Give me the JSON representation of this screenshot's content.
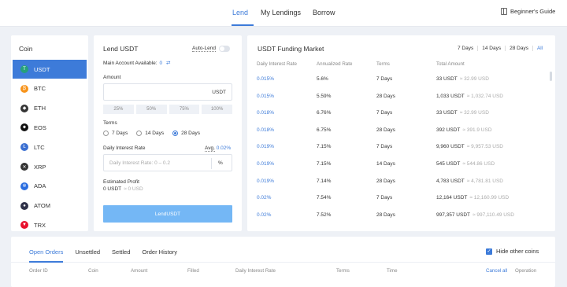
{
  "nav": {
    "tabs": [
      "Lend",
      "My Lendings",
      "Borrow"
    ],
    "guide": "Beginner's Guide"
  },
  "coins": {
    "title": "Coin",
    "items": [
      {
        "symbol": "USDT",
        "color": "#26a17b",
        "glyph": "T"
      },
      {
        "symbol": "BTC",
        "color": "#f7931a",
        "glyph": "₿"
      },
      {
        "symbol": "ETH",
        "color": "#333333",
        "glyph": "◆"
      },
      {
        "symbol": "EOS",
        "color": "#111111",
        "glyph": "⬥"
      },
      {
        "symbol": "LTC",
        "color": "#3b6fd1",
        "glyph": "Ł"
      },
      {
        "symbol": "XRP",
        "color": "#333333",
        "glyph": "✕"
      },
      {
        "symbol": "ADA",
        "color": "#2a6de0",
        "glyph": "✲"
      },
      {
        "symbol": "ATOM",
        "color": "#2e3148",
        "glyph": "●"
      },
      {
        "symbol": "TRX",
        "color": "#e8112d",
        "glyph": "▼"
      }
    ]
  },
  "lend": {
    "title": "Lend USDT",
    "auto_lend": "Auto-Lend",
    "available_label": "Main Account Available:",
    "available_value": "0",
    "amount_label": "Amount",
    "amount_unit": "USDT",
    "percents": [
      "25%",
      "50%",
      "75%",
      "100%"
    ],
    "terms_label": "Terms",
    "terms": [
      "7 Days",
      "14 Days",
      "28 Days"
    ],
    "selected_term": "28 Days",
    "rate_label": "Daily Interest Rate",
    "avg_label": "Avg.",
    "avg_value": "0.02%",
    "rate_placeholder": "Daily Interest Rate: 0 – 0.2",
    "rate_unit": "%",
    "profit_label": "Estimated Profit",
    "profit_value": "0 USDT",
    "profit_sub": "≈ 0 USD",
    "button": "LendUSDT"
  },
  "market": {
    "title": "USDT Funding Market",
    "ranges": [
      "7 Days",
      "14 Days",
      "28 Days",
      "All"
    ],
    "headers": [
      "Daily Interest Rate",
      "Annualized Rate",
      "Terms",
      "Total Amount"
    ],
    "rows": [
      {
        "rate": "0.015%",
        "annual": "5.6%",
        "terms": "7 Days",
        "amount": "33 USDT",
        "usd": "≈ 32.99 USD"
      },
      {
        "rate": "0.015%",
        "annual": "5.59%",
        "terms": "28 Days",
        "amount": "1,033 USDT",
        "usd": "≈ 1,032.74 USD"
      },
      {
        "rate": "0.018%",
        "annual": "6.76%",
        "terms": "7 Days",
        "amount": "33 USDT",
        "usd": "≈ 32.99 USD"
      },
      {
        "rate": "0.018%",
        "annual": "6.75%",
        "terms": "28 Days",
        "amount": "392 USDT",
        "usd": "≈ 391.9 USD"
      },
      {
        "rate": "0.019%",
        "annual": "7.15%",
        "terms": "7 Days",
        "amount": "9,960 USDT",
        "usd": "≈ 9,957.53 USD"
      },
      {
        "rate": "0.019%",
        "annual": "7.15%",
        "terms": "14 Days",
        "amount": "545 USDT",
        "usd": "≈ 544.86 USD"
      },
      {
        "rate": "0.019%",
        "annual": "7.14%",
        "terms": "28 Days",
        "amount": "4,783 USDT",
        "usd": "≈ 4,781.81 USD"
      },
      {
        "rate": "0.02%",
        "annual": "7.54%",
        "terms": "7 Days",
        "amount": "12,164 USDT",
        "usd": "≈ 12,160.99 USD"
      },
      {
        "rate": "0.02%",
        "annual": "7.52%",
        "terms": "28 Days",
        "amount": "997,357 USDT",
        "usd": "≈ 997,110.49 USD"
      }
    ]
  },
  "orders": {
    "tabs": [
      "Open Orders",
      "Unsettled",
      "Settled",
      "Order History"
    ],
    "hide_other": "Hide other coins",
    "headers": [
      "Order ID",
      "Coin",
      "Amount",
      "Filled",
      "Daily Interest Rate",
      "Terms",
      "Time"
    ],
    "cancel_all": "Cancel all",
    "operation": "Operation"
  }
}
